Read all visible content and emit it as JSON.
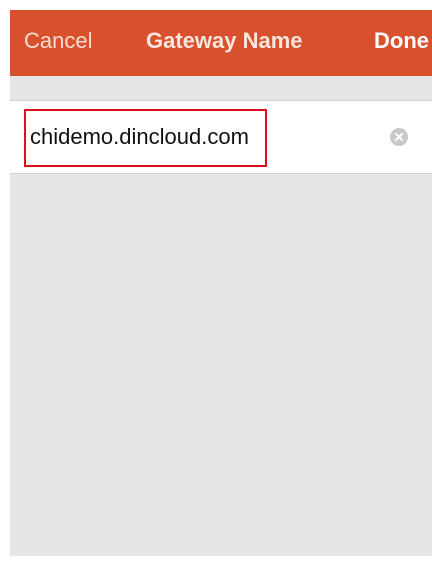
{
  "nav": {
    "cancel_label": "Cancel",
    "title": "Gateway Name",
    "done_label": "Done"
  },
  "gateway": {
    "value": "chidemo.dincloud.com"
  },
  "icons": {
    "clear": "clear-circle-icon"
  },
  "colors": {
    "nav_background": "#d9502c",
    "content_background": "#e6e6e6",
    "highlight": "#e0101a"
  }
}
